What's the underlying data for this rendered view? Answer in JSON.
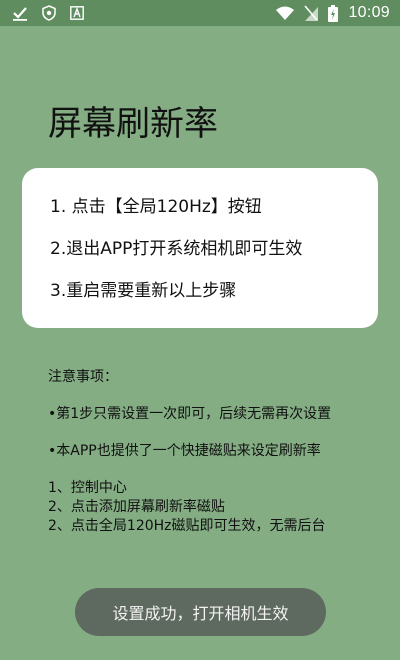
{
  "status_bar": {
    "time": "10:09",
    "icons": [
      "check-notification-icon",
      "shield-icon",
      "font-app-icon",
      "wifi-icon",
      "no-sim-icon",
      "battery-charging-icon"
    ]
  },
  "page": {
    "title": "屏幕刷新率"
  },
  "card": {
    "steps": [
      "1. 点击【全局120Hz】按钮",
      "2.退出APP打开系统相机即可生效",
      "3.重启需要重新以上步骤"
    ]
  },
  "notes": {
    "heading": "注意事项：",
    "items": [
      "•第1步只需设置一次即可，后续无需再次设置",
      "•本APP也提供了一个快捷磁贴来设定刷新率"
    ],
    "list": [
      "1、控制中心",
      "2、点击添加屏幕刷新率磁贴",
      "2、点击全局120Hz磁贴即可生效，无需后台"
    ]
  },
  "toast": {
    "text": "设置成功，打开相机生效"
  },
  "colors": {
    "background": "#84ad84",
    "status_bar": "#5f8d60",
    "card": "#ffffff",
    "toast": "#5e6a5f"
  }
}
